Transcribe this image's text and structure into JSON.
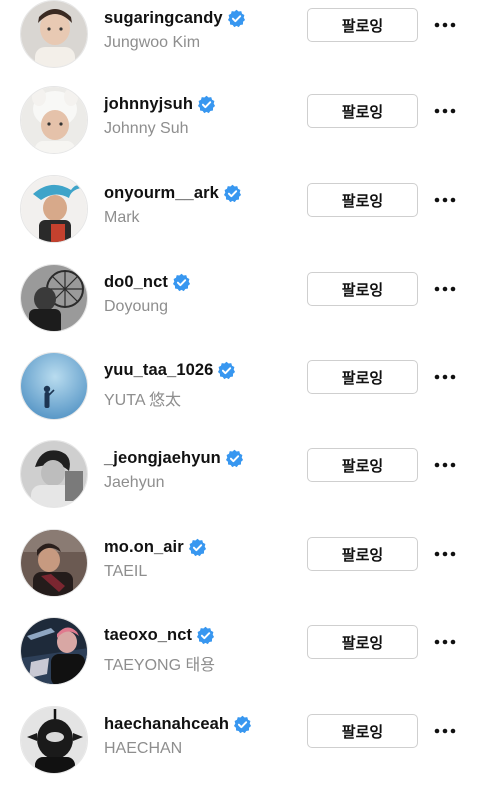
{
  "following_list": [
    {
      "username": "sugaringcandy",
      "full_name": "Jungwoo Kim",
      "verified": true,
      "button_label": "팔로잉"
    },
    {
      "username": "johnnyjsuh",
      "full_name": "Johnny Suh",
      "verified": true,
      "button_label": "팔로잉"
    },
    {
      "username": "onyourm__ark",
      "full_name": "Mark",
      "verified": true,
      "button_label": "팔로잉"
    },
    {
      "username": "do0_nct",
      "full_name": "Doyoung",
      "verified": true,
      "button_label": "팔로잉"
    },
    {
      "username": "yuu_taa_1026",
      "full_name": "YUTA 悠太",
      "verified": true,
      "button_label": "팔로잉"
    },
    {
      "username": "_jeongjaehyun",
      "full_name": "Jaehyun",
      "verified": true,
      "button_label": "팔로잉"
    },
    {
      "username": "mo.on_air",
      "full_name": "TAEIL",
      "verified": true,
      "button_label": "팔로잉"
    },
    {
      "username": "taeoxo_nct",
      "full_name": "TAEYONG 태용",
      "verified": true,
      "button_label": "팔로잉"
    },
    {
      "username": "haechanahceah",
      "full_name": "HAECHAN",
      "verified": true,
      "button_label": "팔로잉"
    }
  ],
  "colors": {
    "verified_badge": "#3897f0",
    "secondary_text": "#8e8e8e",
    "button_border": "#cfcfcf"
  },
  "icons": {
    "verified": "verified-badge-icon",
    "more": "more-options-icon"
  }
}
